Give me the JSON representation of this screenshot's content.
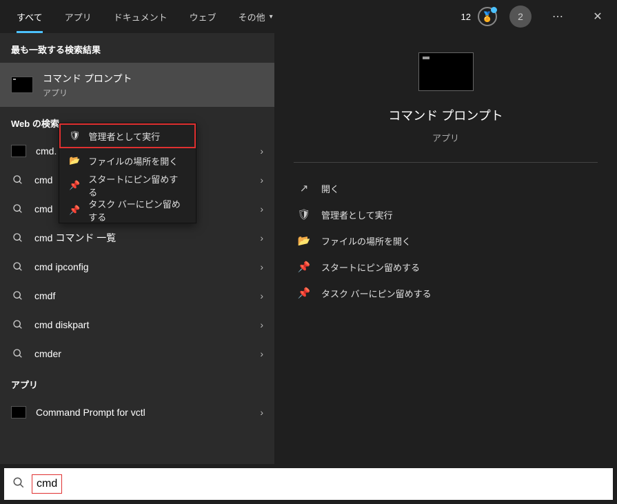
{
  "tabs": {
    "all": "すべて",
    "apps": "アプリ",
    "docs": "ドキュメント",
    "web": "ウェブ",
    "other": "その他"
  },
  "top": {
    "reward": "12",
    "avatar": "2"
  },
  "left": {
    "best_match_header": "最も一致する検索結果",
    "best": {
      "title": "コマンド プロンプト",
      "sub": "アプリ"
    },
    "web_header": "Web の検索",
    "results": {
      "r1": "cmd.",
      "r2": "cmd",
      "r3": "cmd",
      "r4": "cmd コマンド 一覧",
      "r5": "cmd ipconfig",
      "r6": "cmdf",
      "r7": "cmd diskpart",
      "r8": "cmder"
    },
    "apps_header": "アプリ",
    "app1": "Command Prompt for vctl"
  },
  "context": {
    "admin": "管理者として実行",
    "location": "ファイルの場所を開く",
    "pin_start": "スタートにピン留めする",
    "pin_task": "タスク バーにピン留めする"
  },
  "preview": {
    "title": "コマンド プロンプト",
    "sub": "アプリ",
    "open": "開く",
    "admin": "管理者として実行",
    "location": "ファイルの場所を開く",
    "pin_start": "スタートにピン留めする",
    "pin_task": "タスク バーにピン留めする"
  },
  "search": {
    "value": "cmd"
  }
}
